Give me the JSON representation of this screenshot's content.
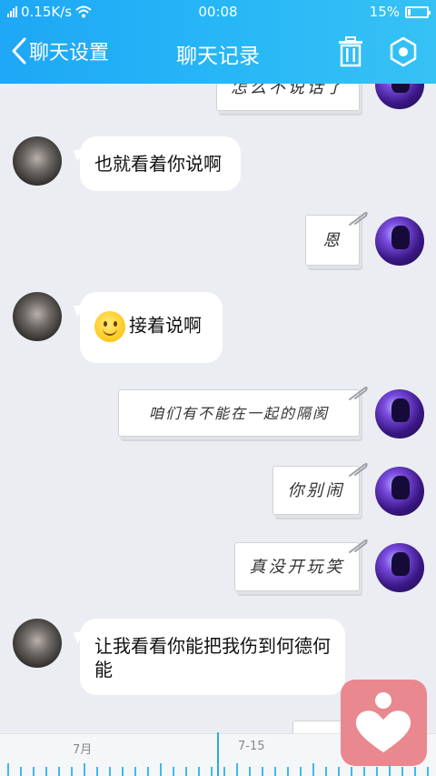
{
  "status_bar": {
    "network_speed": "0.15K/s",
    "time": "00:08",
    "battery": "15%",
    "battery_level": 0.15
  },
  "nav": {
    "back_label": "聊天设置",
    "title": "聊天记录",
    "trash_icon": "trash-icon",
    "settings_icon": "settings-hexagon-icon"
  },
  "messages": [
    {
      "side": "right",
      "type": "note",
      "text": "怎么不说话了"
    },
    {
      "side": "left",
      "type": "text",
      "text": "也就看着你说啊"
    },
    {
      "side": "right",
      "type": "note",
      "text": "恩"
    },
    {
      "side": "left",
      "type": "emoji_text",
      "emoji": "smile-emoji",
      "text": "接着说啊"
    },
    {
      "side": "right",
      "type": "note",
      "text": "咱们有不能在一起的隔阂"
    },
    {
      "side": "right",
      "type": "note",
      "text": "你别闹"
    },
    {
      "side": "right",
      "type": "note",
      "text": "真没开玩笑"
    },
    {
      "side": "left",
      "type": "text",
      "text": "让我看看你能把我伤到何德何能"
    }
  ],
  "timeline": {
    "labels": [
      "7月",
      "7-15"
    ]
  },
  "colors": {
    "header": "#27b6f6",
    "accent": "#3fb8ef",
    "fab": "#e9888e"
  }
}
